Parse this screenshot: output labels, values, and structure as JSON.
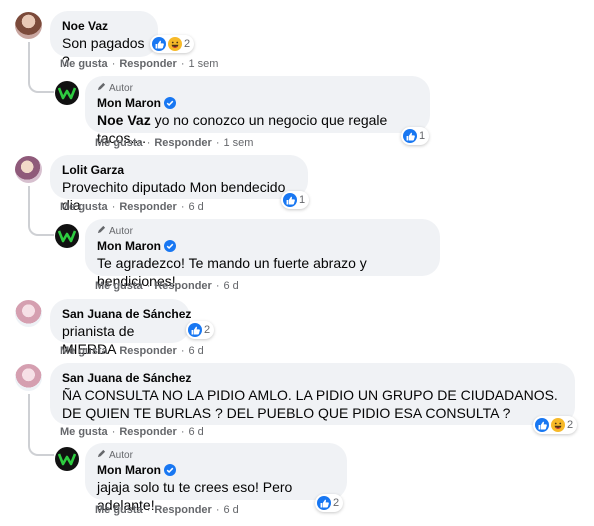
{
  "comments": [
    {
      "name": "Noe Vaz",
      "text": "Son pagados ?",
      "reaction_count": "2",
      "like": "Me gusta",
      "reply": "Responder",
      "time": "1 sem"
    },
    {
      "author_badge": "Autor",
      "name": "Mon Maron",
      "mention": "Noe Vaz",
      "text": " yo no conozco un negocio que regale tacos....",
      "reaction_count": "1",
      "like": "Me gusta",
      "reply": "Responder",
      "time": "1 sem"
    },
    {
      "name": "Lolit Garza",
      "text": "Provechito diputado Mon bendecido dia",
      "reaction_count": "1",
      "like": "Me gusta",
      "reply": "Responder",
      "time": "6 d"
    },
    {
      "author_badge": "Autor",
      "name": "Mon Maron",
      "text": "Te agradezco! Te mando un fuerte abrazo y bendiciones!",
      "like": "Me gusta",
      "reply": "Responder",
      "time": "6 d"
    },
    {
      "name": "San Juana de Sánchez",
      "text": "prianista de MIERDA",
      "reaction_count": "2",
      "like": "Me gusta",
      "reply": "Responder",
      "time": "6 d"
    },
    {
      "name": "San Juana de Sánchez",
      "text": "ÑA CONSULTA NO LA PIDIO AMLO. LA PIDIO UN GRUPO DE CIUDADANOS. DE QUIEN TE BURLAS ? DEL PUEBLO QUE PIDIO ESA CONSULTA ?",
      "reaction_count": "2",
      "like": "Me gusta",
      "reply": "Responder",
      "time": "6 d"
    },
    {
      "author_badge": "Autor",
      "name": "Mon Maron",
      "text": "jajaja solo tu te crees eso! Pero adelante!",
      "reaction_count": "2",
      "like": "Me gusta",
      "reply": "Responder",
      "time": "6 d"
    }
  ],
  "icons": {
    "like": "thumbs-up-icon",
    "haha": "haha-icon",
    "pencil": "pencil-icon",
    "verified": "verified-badge-icon"
  },
  "colors": {
    "like_blue": "#1877f2",
    "haha_yellow": "#f7b928",
    "bubble": "#f0f2f5",
    "meta_gray": "#65676b",
    "thread_line": "#ced0d4"
  }
}
